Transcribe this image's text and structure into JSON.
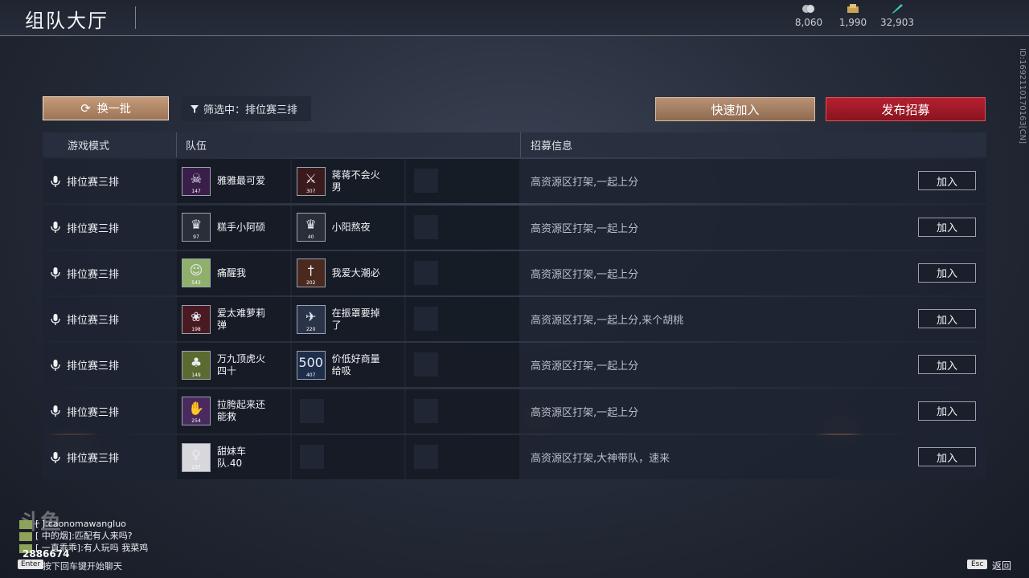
{
  "header": {
    "title": "组队大厅",
    "currencies": [
      {
        "icon": "silver-coin-icon",
        "value": "8,060"
      },
      {
        "icon": "gold-bar-icon",
        "value": "1,990"
      },
      {
        "icon": "feather-icon",
        "value": "32,903"
      }
    ],
    "side_id": "ID:1692110170163[CN]"
  },
  "toolbar": {
    "refresh_label": "换一批",
    "filter_label": "筛选中：排位赛三排",
    "quick_join_label": "快速加入",
    "post_label": "发布招募"
  },
  "table": {
    "columns": {
      "mode": "游戏模式",
      "team": "队伍",
      "info": "招募信息"
    },
    "join_label": "加入",
    "rows": [
      {
        "mode": "排位赛三排",
        "info": "高资源区打架,一起上分",
        "members": [
          {
            "name": "雅雅最可爱",
            "level": "147",
            "avatar": "demon"
          },
          {
            "name": "蒋蒋不会火男",
            "level": "307",
            "avatar": "slash"
          }
        ]
      },
      {
        "mode": "排位赛三排",
        "info": "高资源区打架,一起上分",
        "members": [
          {
            "name": "糕手小阿硕",
            "level": "97",
            "avatar": "crest"
          },
          {
            "name": "小阳熬夜",
            "level": "40",
            "avatar": "crest"
          }
        ]
      },
      {
        "mode": "排位赛三排",
        "info": "高资源区打架,一起上分",
        "members": [
          {
            "name": "痛醒我",
            "level": "543",
            "avatar": "face"
          },
          {
            "name": "我爱大潮必",
            "level": "202",
            "avatar": "blade"
          }
        ]
      },
      {
        "mode": "排位赛三排",
        "info": "高资源区打架,一起上分,来个胡桃",
        "members": [
          {
            "name": "爱太难萝莉弹",
            "level": "198",
            "avatar": "rose"
          },
          {
            "name": "在振罩要掉了",
            "level": "220",
            "avatar": "bird"
          }
        ]
      },
      {
        "mode": "排位赛三排",
        "info": "高资源区打架,一起上分",
        "members": [
          {
            "name": "万九顶虎火四十",
            "level": "149",
            "avatar": "bag"
          },
          {
            "name": "价低好商量给吸",
            "level": "407",
            "avatar": "500"
          }
        ]
      },
      {
        "mode": "排位赛三排",
        "info": "高资源区打架,一起上分",
        "members": [
          {
            "name": "拉胯起来还能救",
            "level": "254",
            "avatar": "hand"
          }
        ]
      },
      {
        "mode": "排位赛三排",
        "info": "高资源区打架,大神带队，速来",
        "members": [
          {
            "name": "甜妹车队.40",
            "level": "237",
            "avatar": "girl"
          }
        ]
      }
    ]
  },
  "chat": {
    "lines": [
      {
        "text": "[ ]:caonomawangluo"
      },
      {
        "text": "[ 中的烟]:匹配有人来吗?"
      },
      {
        "text": "[ 一直乖乖]:有人玩吗 我菜鸡"
      }
    ],
    "room_number": "2886674",
    "enter_key": "Enter",
    "enter_hint": "按下回车键开始聊天"
  },
  "footer": {
    "esc_key": "Esc",
    "back_label": "返回"
  },
  "colors": {
    "accent_red": "#b52030",
    "accent_tan": "#b99274",
    "panel": "#1e2431"
  }
}
